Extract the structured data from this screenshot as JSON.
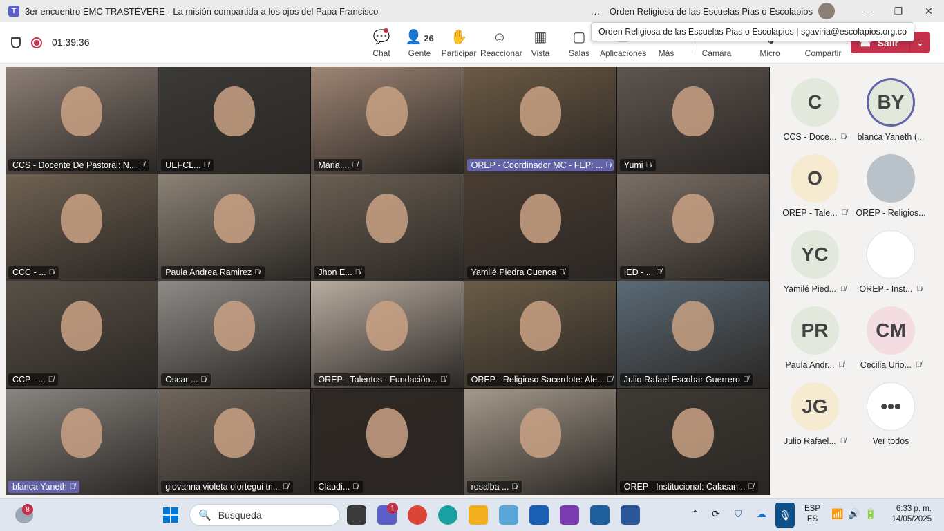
{
  "window": {
    "title": "3er encuentro EMC TRASTÉVERE - La misión compartida a los ojos del Papa Francisco",
    "org": "Orden Religiosa de las Escuelas Pias o Escolapios",
    "more": "...",
    "minimize": "—",
    "maximize": "❐",
    "close": "✕"
  },
  "tooltip": "Orden Religiosa de las Escuelas Pias o Escolapios | sgaviria@escolapios.org.co",
  "toolbar": {
    "timer": "01:39:36",
    "people_count": "26",
    "buttons": {
      "chat": "Chat",
      "people": "Gente",
      "raise": "Participar",
      "react": "Reaccionar",
      "view": "Vista",
      "rooms": "Salas",
      "apps": "Aplicaciones",
      "more": "Más",
      "camera": "Cámara",
      "mic": "Micro",
      "share": "Compartir"
    },
    "leave": "Salir"
  },
  "tiles": [
    {
      "name": "CCS - Docente De Pastoral: N...",
      "color": "#8d7f76",
      "active": false
    },
    {
      "name": "UEFCL...",
      "color": "#3b3a36",
      "active": false
    },
    {
      "name": "Maria ...",
      "color": "#9e8574",
      "active": false
    },
    {
      "name": "OREP - Coordinador MC - FEP: ...",
      "color": "#6c5a44",
      "active": true
    },
    {
      "name": "Yumi",
      "color": "#5d5550",
      "active": false
    },
    {
      "name": "CCC - ...",
      "color": "#6f6252",
      "active": false
    },
    {
      "name": "Paula  Andrea Ramirez",
      "color": "#8c8376",
      "active": false
    },
    {
      "name": "Jhon E...",
      "color": "#6a5f53",
      "active": false
    },
    {
      "name": "Yamilé Piedra Cuenca",
      "color": "#4a3d33",
      "active": false
    },
    {
      "name": "IED - ...",
      "color": "#7a6f66",
      "active": false
    },
    {
      "name": "CCP - ...",
      "color": "#585047",
      "active": false
    },
    {
      "name": "Oscar ...",
      "color": "#8e8a86",
      "active": false
    },
    {
      "name": "OREP - Talentos - Fundación...",
      "color": "#b8aca0",
      "active": false
    },
    {
      "name": "OREP - Religioso Sacerdote: Ale...",
      "color": "#6a5c46",
      "active": false
    },
    {
      "name": "Julio Rafael Escobar Guerrero",
      "color": "#5a6a76",
      "active": false
    },
    {
      "name": "blanca Yaneth",
      "color": "#8a8580",
      "active": true
    },
    {
      "name": "giovanna violeta olortegui tri...",
      "color": "#70665c",
      "active": false
    },
    {
      "name": "Claudi...",
      "color": "#2f2824",
      "active": false
    },
    {
      "name": "rosalba ...",
      "color": "#a59a8c",
      "active": false
    },
    {
      "name": "OREP - Institucional: Calasan...",
      "color": "#3f3a34",
      "active": false
    }
  ],
  "roster": [
    {
      "initials": "C",
      "name": "CCS - Doce...",
      "bg": "#e2e8dc",
      "muted": true
    },
    {
      "initials": "BY",
      "name": "blanca Yaneth (...",
      "bg": "#e2e8dc",
      "muted": false
    },
    {
      "initials": "O",
      "name": "OREP - Tale...",
      "bg": "#f6ead0",
      "muted": true
    },
    {
      "initials": "",
      "name": "OREP - Religios...",
      "bg": "#b9c2c9",
      "muted": false
    },
    {
      "initials": "YC",
      "name": "Yamilé Pied...",
      "bg": "#e2e8dc",
      "muted": true
    },
    {
      "initials": "",
      "name": "OREP - Inst...",
      "bg": "#ffffff",
      "muted": true
    },
    {
      "initials": "PR",
      "name": "Paula Andr...",
      "bg": "#e2e8dc",
      "muted": true
    },
    {
      "initials": "CM",
      "name": "Cecilia Urio...",
      "bg": "#f4dde2",
      "muted": true
    },
    {
      "initials": "JG",
      "name": "Julio Rafael...",
      "bg": "#f6ead0",
      "muted": true
    },
    {
      "initials": "•••",
      "name": "Ver todos",
      "bg": "#ffffff",
      "muted": false
    }
  ],
  "taskbar": {
    "weather_badge": "8",
    "search_placeholder": "Búsqueda",
    "teams_badge": "1",
    "lang_top": "ESP",
    "lang_bottom": "ES",
    "time": "6:33 p. m.",
    "date": "14/05/2025"
  },
  "colors": {
    "accent": "#6264a7",
    "leave": "#c4314b",
    "teams": "#5b5fc7"
  }
}
